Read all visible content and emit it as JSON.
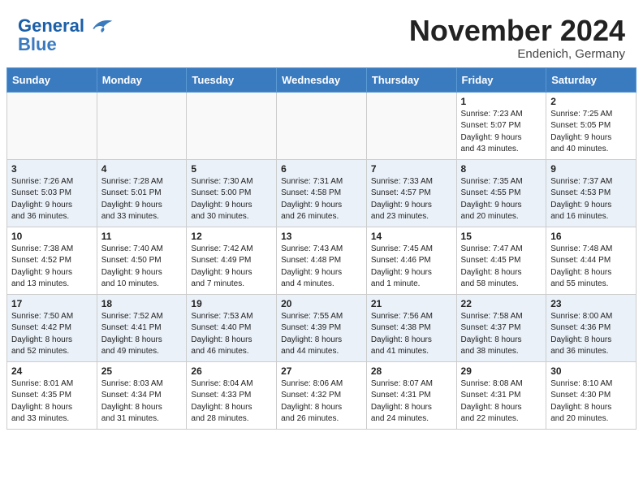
{
  "header": {
    "logo_line1": "General",
    "logo_line2": "Blue",
    "month": "November 2024",
    "location": "Endenich, Germany"
  },
  "weekdays": [
    "Sunday",
    "Monday",
    "Tuesday",
    "Wednesday",
    "Thursday",
    "Friday",
    "Saturday"
  ],
  "weeks": [
    [
      {
        "day": "",
        "info": ""
      },
      {
        "day": "",
        "info": ""
      },
      {
        "day": "",
        "info": ""
      },
      {
        "day": "",
        "info": ""
      },
      {
        "day": "",
        "info": ""
      },
      {
        "day": "1",
        "info": "Sunrise: 7:23 AM\nSunset: 5:07 PM\nDaylight: 9 hours\nand 43 minutes."
      },
      {
        "day": "2",
        "info": "Sunrise: 7:25 AM\nSunset: 5:05 PM\nDaylight: 9 hours\nand 40 minutes."
      }
    ],
    [
      {
        "day": "3",
        "info": "Sunrise: 7:26 AM\nSunset: 5:03 PM\nDaylight: 9 hours\nand 36 minutes."
      },
      {
        "day": "4",
        "info": "Sunrise: 7:28 AM\nSunset: 5:01 PM\nDaylight: 9 hours\nand 33 minutes."
      },
      {
        "day": "5",
        "info": "Sunrise: 7:30 AM\nSunset: 5:00 PM\nDaylight: 9 hours\nand 30 minutes."
      },
      {
        "day": "6",
        "info": "Sunrise: 7:31 AM\nSunset: 4:58 PM\nDaylight: 9 hours\nand 26 minutes."
      },
      {
        "day": "7",
        "info": "Sunrise: 7:33 AM\nSunset: 4:57 PM\nDaylight: 9 hours\nand 23 minutes."
      },
      {
        "day": "8",
        "info": "Sunrise: 7:35 AM\nSunset: 4:55 PM\nDaylight: 9 hours\nand 20 minutes."
      },
      {
        "day": "9",
        "info": "Sunrise: 7:37 AM\nSunset: 4:53 PM\nDaylight: 9 hours\nand 16 minutes."
      }
    ],
    [
      {
        "day": "10",
        "info": "Sunrise: 7:38 AM\nSunset: 4:52 PM\nDaylight: 9 hours\nand 13 minutes."
      },
      {
        "day": "11",
        "info": "Sunrise: 7:40 AM\nSunset: 4:50 PM\nDaylight: 9 hours\nand 10 minutes."
      },
      {
        "day": "12",
        "info": "Sunrise: 7:42 AM\nSunset: 4:49 PM\nDaylight: 9 hours\nand 7 minutes."
      },
      {
        "day": "13",
        "info": "Sunrise: 7:43 AM\nSunset: 4:48 PM\nDaylight: 9 hours\nand 4 minutes."
      },
      {
        "day": "14",
        "info": "Sunrise: 7:45 AM\nSunset: 4:46 PM\nDaylight: 9 hours\nand 1 minute."
      },
      {
        "day": "15",
        "info": "Sunrise: 7:47 AM\nSunset: 4:45 PM\nDaylight: 8 hours\nand 58 minutes."
      },
      {
        "day": "16",
        "info": "Sunrise: 7:48 AM\nSunset: 4:44 PM\nDaylight: 8 hours\nand 55 minutes."
      }
    ],
    [
      {
        "day": "17",
        "info": "Sunrise: 7:50 AM\nSunset: 4:42 PM\nDaylight: 8 hours\nand 52 minutes."
      },
      {
        "day": "18",
        "info": "Sunrise: 7:52 AM\nSunset: 4:41 PM\nDaylight: 8 hours\nand 49 minutes."
      },
      {
        "day": "19",
        "info": "Sunrise: 7:53 AM\nSunset: 4:40 PM\nDaylight: 8 hours\nand 46 minutes."
      },
      {
        "day": "20",
        "info": "Sunrise: 7:55 AM\nSunset: 4:39 PM\nDaylight: 8 hours\nand 44 minutes."
      },
      {
        "day": "21",
        "info": "Sunrise: 7:56 AM\nSunset: 4:38 PM\nDaylight: 8 hours\nand 41 minutes."
      },
      {
        "day": "22",
        "info": "Sunrise: 7:58 AM\nSunset: 4:37 PM\nDaylight: 8 hours\nand 38 minutes."
      },
      {
        "day": "23",
        "info": "Sunrise: 8:00 AM\nSunset: 4:36 PM\nDaylight: 8 hours\nand 36 minutes."
      }
    ],
    [
      {
        "day": "24",
        "info": "Sunrise: 8:01 AM\nSunset: 4:35 PM\nDaylight: 8 hours\nand 33 minutes."
      },
      {
        "day": "25",
        "info": "Sunrise: 8:03 AM\nSunset: 4:34 PM\nDaylight: 8 hours\nand 31 minutes."
      },
      {
        "day": "26",
        "info": "Sunrise: 8:04 AM\nSunset: 4:33 PM\nDaylight: 8 hours\nand 28 minutes."
      },
      {
        "day": "27",
        "info": "Sunrise: 8:06 AM\nSunset: 4:32 PM\nDaylight: 8 hours\nand 26 minutes."
      },
      {
        "day": "28",
        "info": "Sunrise: 8:07 AM\nSunset: 4:31 PM\nDaylight: 8 hours\nand 24 minutes."
      },
      {
        "day": "29",
        "info": "Sunrise: 8:08 AM\nSunset: 4:31 PM\nDaylight: 8 hours\nand 22 minutes."
      },
      {
        "day": "30",
        "info": "Sunrise: 8:10 AM\nSunset: 4:30 PM\nDaylight: 8 hours\nand 20 minutes."
      }
    ]
  ]
}
